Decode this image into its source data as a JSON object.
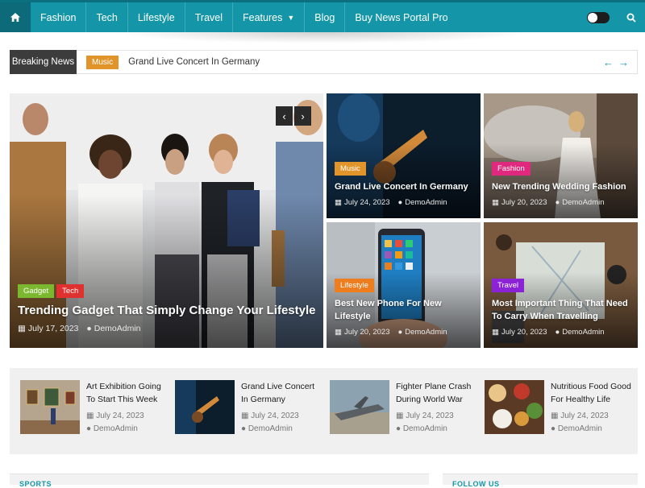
{
  "nav": {
    "items": [
      {
        "label": "Fashion"
      },
      {
        "label": "Tech"
      },
      {
        "label": "Lifestyle"
      },
      {
        "label": "Travel"
      },
      {
        "label": "Features"
      },
      {
        "label": "Blog"
      },
      {
        "label": "Buy News Portal Pro"
      }
    ],
    "icons": {
      "home": "home-icon",
      "theme": "dark-mode-toggle",
      "search": "search-icon"
    },
    "colors": {
      "bar": "#1496a8",
      "home": "#0c6a79"
    }
  },
  "ticker": {
    "label": "Breaking News",
    "tag": "Music",
    "text": "Grand Live Concert In Germany"
  },
  "hero": {
    "tags": [
      "Gadget",
      "Tech"
    ],
    "title": "Trending Gadget That Simply Change Your Lifestyle",
    "date": "July 17, 2023",
    "author": "DemoAdmin"
  },
  "grid": [
    {
      "tag": "Music",
      "title": "Grand Live Concert In Germany",
      "date": "July 24, 2023",
      "author": "DemoAdmin"
    },
    {
      "tag": "Fashion",
      "title": "New Trending Wedding Fashion",
      "date": "July 20, 2023",
      "author": "DemoAdmin"
    },
    {
      "tag": "Lifestyle",
      "title": "Best New Phone For New Lifestyle",
      "date": "July 20, 2023",
      "author": "DemoAdmin"
    },
    {
      "tag": "Travel",
      "title": "Most Important Thing That Need To Carry When Travelling",
      "date": "July 20, 2023",
      "author": "DemoAdmin"
    }
  ],
  "strip": [
    {
      "title": "Art Exhibition Going To Start This Week",
      "date": "July 24, 2023",
      "author": "DemoAdmin"
    },
    {
      "title": "Grand Live Concert In Germany",
      "date": "July 24, 2023",
      "author": "DemoAdmin"
    },
    {
      "title": "Fighter Plane Crash During World War",
      "date": "July 24, 2023",
      "author": "DemoAdmin"
    },
    {
      "title": "Nutritious Food Good For Healthy Life",
      "date": "July 24, 2023",
      "author": "DemoAdmin"
    }
  ],
  "sections": {
    "left": "SPORTS",
    "right": "FOLLOW US"
  },
  "tag_colors": {
    "music": "#e1942a",
    "fashion": "#e0287e",
    "lifestyle": "#ee7d1e",
    "travel": "#8b22d6",
    "gadget": "#7cb82f",
    "tech": "#e03131"
  }
}
